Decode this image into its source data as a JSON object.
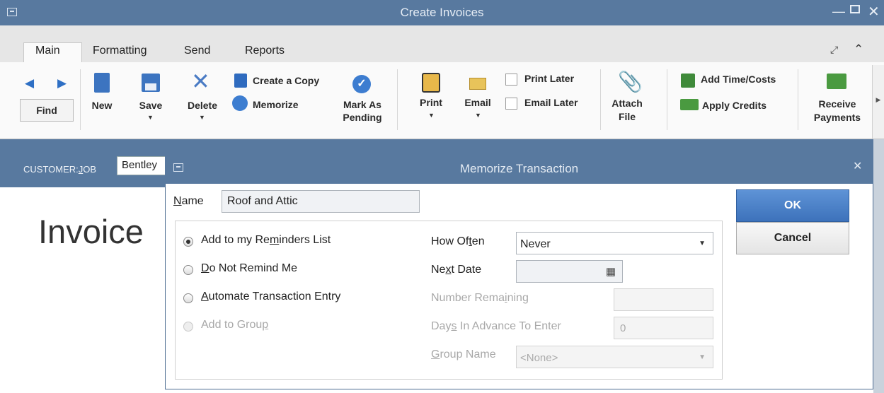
{
  "window": {
    "title": "Create Invoices"
  },
  "tabs": [
    "Main",
    "Formatting",
    "Send",
    "Reports"
  ],
  "ribbon": {
    "find": "Find",
    "new": "New",
    "save": "Save",
    "delete": "Delete",
    "create_copy": "Create a Copy",
    "memorize": "Memorize",
    "mark_pending_1": "Mark As",
    "mark_pending_2": "Pending",
    "print": "Print",
    "email": "Email",
    "print_later": "Print Later",
    "email_later": "Email Later",
    "attach_1": "Attach",
    "attach_2": "File",
    "add_time_costs": "Add Time/Costs",
    "apply_credits": "Apply Credits",
    "receive_1": "Receive",
    "receive_2": "Payments"
  },
  "customer": {
    "value": "Bentley"
  },
  "invoice_heading": "Invoice",
  "dialog": {
    "title": "Memorize Transaction",
    "name_value": "Roof and Attic",
    "ok": "OK",
    "cancel": "Cancel",
    "how_often_label": "How Often",
    "how_often_value": "Never",
    "next_date_label_pre": "Ne",
    "next_date_label_u": "x",
    "next_date_label_post": "t Date",
    "number_remaining_label": "Number Remaining",
    "days_in_advance_label": "Days In Advance To Enter",
    "days_in_advance_value": "0",
    "group_name_label": "Group Name",
    "group_name_value": "<None>"
  }
}
